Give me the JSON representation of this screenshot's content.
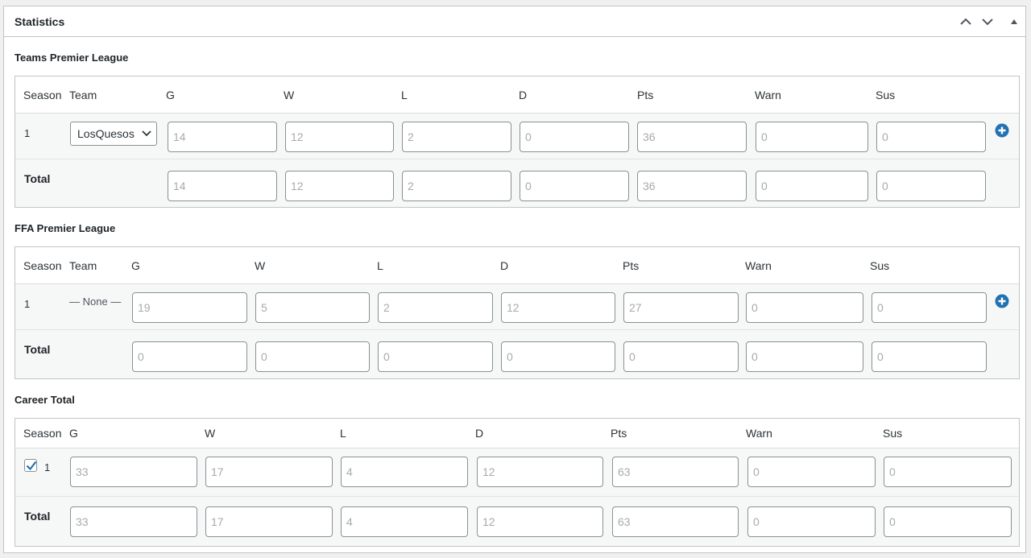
{
  "panel": {
    "title": "Statistics",
    "controls": [
      "move-up",
      "move-down",
      "toggle-panel"
    ]
  },
  "columns_short": [
    "G",
    "W",
    "L",
    "D",
    "Pts",
    "Warn",
    "Sus"
  ],
  "sections": [
    {
      "title": "Teams Premier League",
      "season_label": "Season",
      "team_label": "Team",
      "rows": [
        {
          "season": "1",
          "team": "LosQuesos",
          "values": [
            "14",
            "12",
            "2",
            "0",
            "36",
            "0",
            "0"
          ]
        }
      ],
      "total_label": "Total",
      "totals": [
        "14",
        "12",
        "2",
        "0",
        "36",
        "0",
        "0"
      ]
    },
    {
      "title": "FFA Premier League",
      "season_label": "Season",
      "team_label": "Team",
      "rows": [
        {
          "season": "1",
          "team": "— None —",
          "values": [
            "19",
            "5",
            "2",
            "12",
            "27",
            "0",
            "0"
          ]
        }
      ],
      "total_label": "Total",
      "totals": [
        "0",
        "0",
        "0",
        "0",
        "0",
        "0",
        "0"
      ]
    },
    {
      "title": "Career Total",
      "season_label": "Season",
      "rows": [
        {
          "season": "1",
          "checked": true,
          "values": [
            "33",
            "17",
            "4",
            "12",
            "63",
            "0",
            "0"
          ]
        }
      ],
      "total_label": "Total",
      "totals": [
        "33",
        "17",
        "4",
        "12",
        "63",
        "0",
        "0"
      ]
    }
  ],
  "colors": {
    "accent": "#2271b1",
    "border": "#c3c4c7",
    "row_bg": "#f6f7f7",
    "input_border": "#8c8f94",
    "placeholder_text": "#a7aaad"
  }
}
